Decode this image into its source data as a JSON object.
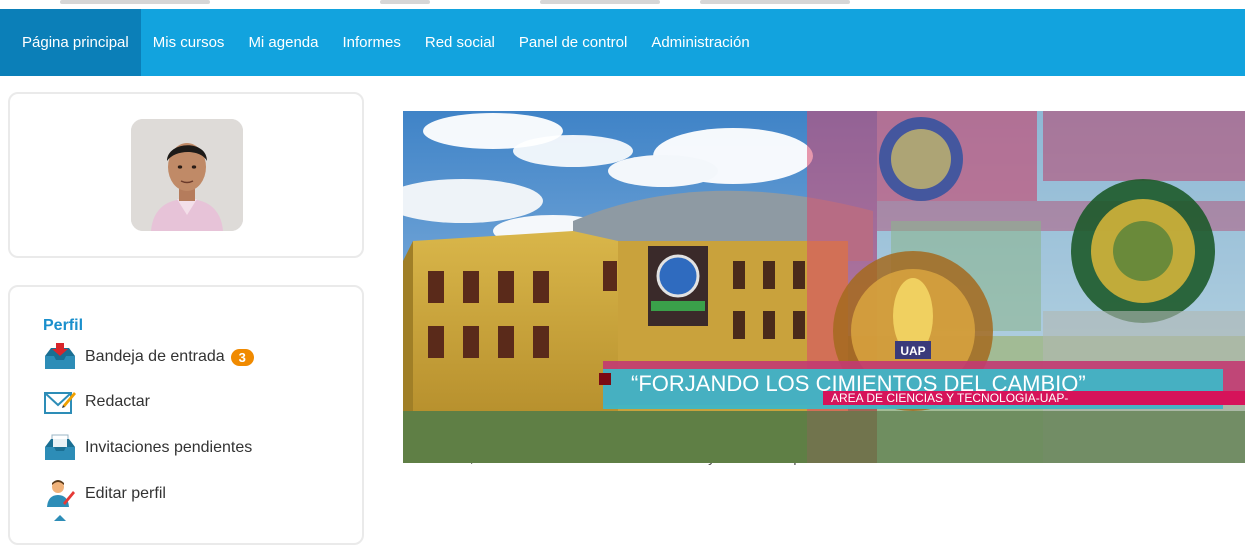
{
  "nav": {
    "items": [
      {
        "label": "Página principal",
        "active": true
      },
      {
        "label": "Mis cursos"
      },
      {
        "label": "Mi agenda"
      },
      {
        "label": "Informes"
      },
      {
        "label": "Red social"
      },
      {
        "label": "Panel de control"
      },
      {
        "label": "Administración"
      }
    ]
  },
  "profile_menu": {
    "title": "Perfil",
    "items": [
      {
        "label": "Bandeja de entrada",
        "badge": "3",
        "icon": "inbox-icon"
      },
      {
        "label": "Redactar",
        "icon": "compose-icon"
      },
      {
        "label": "Invitaciones pendientes",
        "icon": "invitations-icon"
      },
      {
        "label": "Editar perfil",
        "icon": "edit-profile-icon"
      }
    ]
  },
  "banner": {
    "slogan": "“FORJANDO LOS CIMIENTOS DEL CAMBIO”",
    "subtitle": "AREA DE CIENCIAS Y TECNOLOGIA-UAP-",
    "plaque": "UAP",
    "caption": "Diviértase, no dude en unirse a la comunidad y denos su opinión a través de nuestro foro."
  },
  "colors": {
    "navbar": "#12a3de",
    "active": "#0b7fb8",
    "badge": "#f08a00",
    "title": "#1a8fcc"
  }
}
